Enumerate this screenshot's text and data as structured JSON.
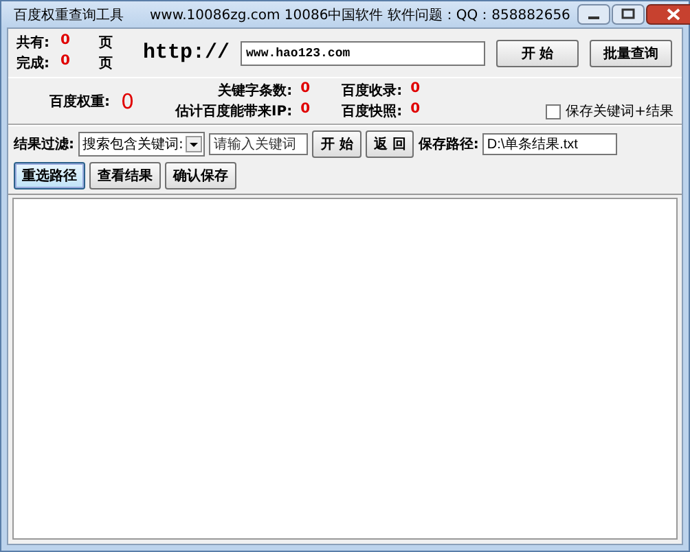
{
  "window": {
    "title": "百度权重查询工具",
    "info": "www.10086zg.com 10086中国软件   软件问题：QQ：858882656"
  },
  "counters": [
    {
      "label": "共有:",
      "value": "0",
      "unit": "页"
    },
    {
      "label": "完成:",
      "value": "0",
      "unit": "页"
    }
  ],
  "url": {
    "prefix": "http://",
    "value": "www.hao123.com"
  },
  "top_buttons": [
    "开  始",
    "批量查询"
  ],
  "stats": [
    {
      "label": "百度权重:",
      "value": "0",
      "kind": "big"
    },
    {
      "label": "关键字条数:",
      "value": "0",
      "kind": "small"
    },
    {
      "label": "百度收录:",
      "value": "0",
      "kind": "small"
    },
    {
      "label": "估计百度能带来IP:",
      "value": "0",
      "kind": "small"
    },
    {
      "label": "百度快照:",
      "value": "0",
      "kind": "small"
    }
  ],
  "save_checkbox": {
    "label": "保存关键词+结果",
    "checked": false
  },
  "filter": {
    "label": "结果过滤:",
    "select": "搜索包含关键词:",
    "keyword": {
      "placeholder": "请输入关键词"
    }
  },
  "filter_buttons": [
    "开 始",
    "返 回"
  ],
  "save_path": {
    "label": "保存路径:",
    "value": "D:\\单条结果.txt"
  },
  "path_buttons": [
    {
      "label": "重选路径",
      "selected": true
    },
    {
      "label": "查看结果",
      "selected": false
    },
    {
      "label": "确认保存",
      "selected": false
    }
  ]
}
